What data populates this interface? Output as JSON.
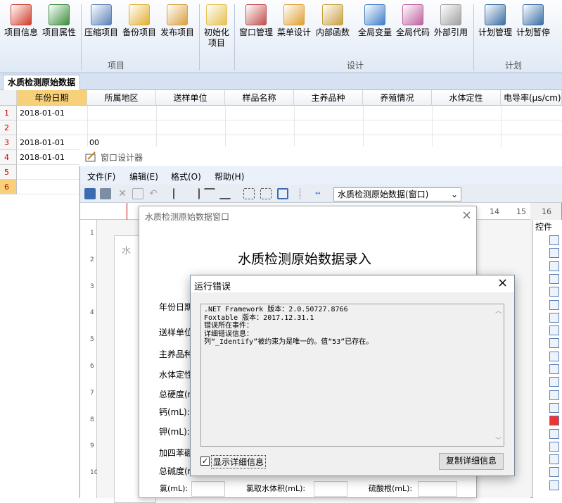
{
  "ribbon": {
    "buttons": [
      {
        "label": "项目信息",
        "icon": "certificate-icon",
        "color": "#d23b2a"
      },
      {
        "label": "项目属性",
        "icon": "properties-icon",
        "color": "#3c8f3c"
      },
      {
        "label": "压缩项目",
        "icon": "compress-tools-icon",
        "color": "#5b82b8"
      },
      {
        "label": "备份项目",
        "icon": "backup-database-icon",
        "color": "#e0b030"
      },
      {
        "label": "发布项目",
        "icon": "publish-icon",
        "color": "#d9a040"
      },
      {
        "label": "初始化\n项目",
        "icon": "init-document-icon",
        "color": "#e6c050"
      },
      {
        "label": "窗口管理",
        "icon": "window-manage-icon",
        "color": "#c0504d"
      },
      {
        "label": "菜单设计",
        "icon": "menu-design-icon",
        "color": "#e0a030"
      },
      {
        "label": "内部函数",
        "icon": "functions-icon",
        "color": "#c8a040"
      },
      {
        "label": "全局变量",
        "icon": "global-variables-icon",
        "color": "#3f7fc8"
      },
      {
        "label": "全局代码",
        "icon": "global-code-icon",
        "color": "#c060a0"
      },
      {
        "label": "外部引用",
        "icon": "external-reference-icon",
        "color": "#a0a0a0"
      },
      {
        "label": "计划管理",
        "icon": "schedule-icon",
        "color": "#3a6ea5"
      },
      {
        "label": "计划暂停",
        "icon": "pause-icon",
        "color": "#3a6ea5"
      }
    ],
    "groups": [
      "项目",
      "设计",
      "计划"
    ]
  },
  "tab": {
    "label": "水质检测原始数据"
  },
  "grid": {
    "columns": [
      "年份日期",
      "所属地区",
      "送样单位",
      "样品名称",
      "主养品种",
      "养殖情况",
      "水体定性",
      "电导率(μs/cm)"
    ],
    "rows": [
      {
        "n": "1",
        "date": "2018-01-01",
        "region": ""
      },
      {
        "n": "2",
        "date": "",
        "region": ""
      },
      {
        "n": "3",
        "date": "2018-01-01",
        "region": "00"
      },
      {
        "n": "4",
        "date": "2018-01-01",
        "region": ""
      },
      {
        "n": "5",
        "date": "",
        "region": ""
      },
      {
        "n": "6",
        "date": "",
        "region": ""
      }
    ]
  },
  "designer": {
    "title": "窗口设计器",
    "menus": [
      "文件(F)",
      "编辑(E)",
      "格式(O)",
      "帮助(H)"
    ],
    "combo": "水质检测原始数据(窗口)",
    "ruler_marks": [
      "14",
      "15",
      "16"
    ],
    "vruler_marks": [
      "1",
      "2",
      "3",
      "4",
      "5",
      "6",
      "7",
      "8",
      "9",
      "10"
    ],
    "controls_title": "控件",
    "bg_form_label": "水"
  },
  "form": {
    "title": "水质检测原始数据窗口",
    "heading": "水质检测原始数据录入",
    "labels": [
      "年份日期",
      "送样单位",
      "主养品种",
      "水体定性",
      "总硬度(m",
      "钙(mL):",
      "钾(mL):",
      "加四苯硼",
      "总碱度(m"
    ],
    "bottom_labels": [
      "氯(mL):",
      "氯取水体积(mL):",
      "硫酸根(mL):"
    ]
  },
  "error": {
    "title": "运行错误",
    "text": ".NET Framework 版本：2.0.50727.8766\nFoxtable 版本：2017.12.31.1\n错误所在事件：\n详细错误信息：\n列“_Identify”被约束为是唯一的。值“53”已存在。",
    "checkbox_label": "显示详细信息",
    "copy_button": "复制详细信息"
  }
}
